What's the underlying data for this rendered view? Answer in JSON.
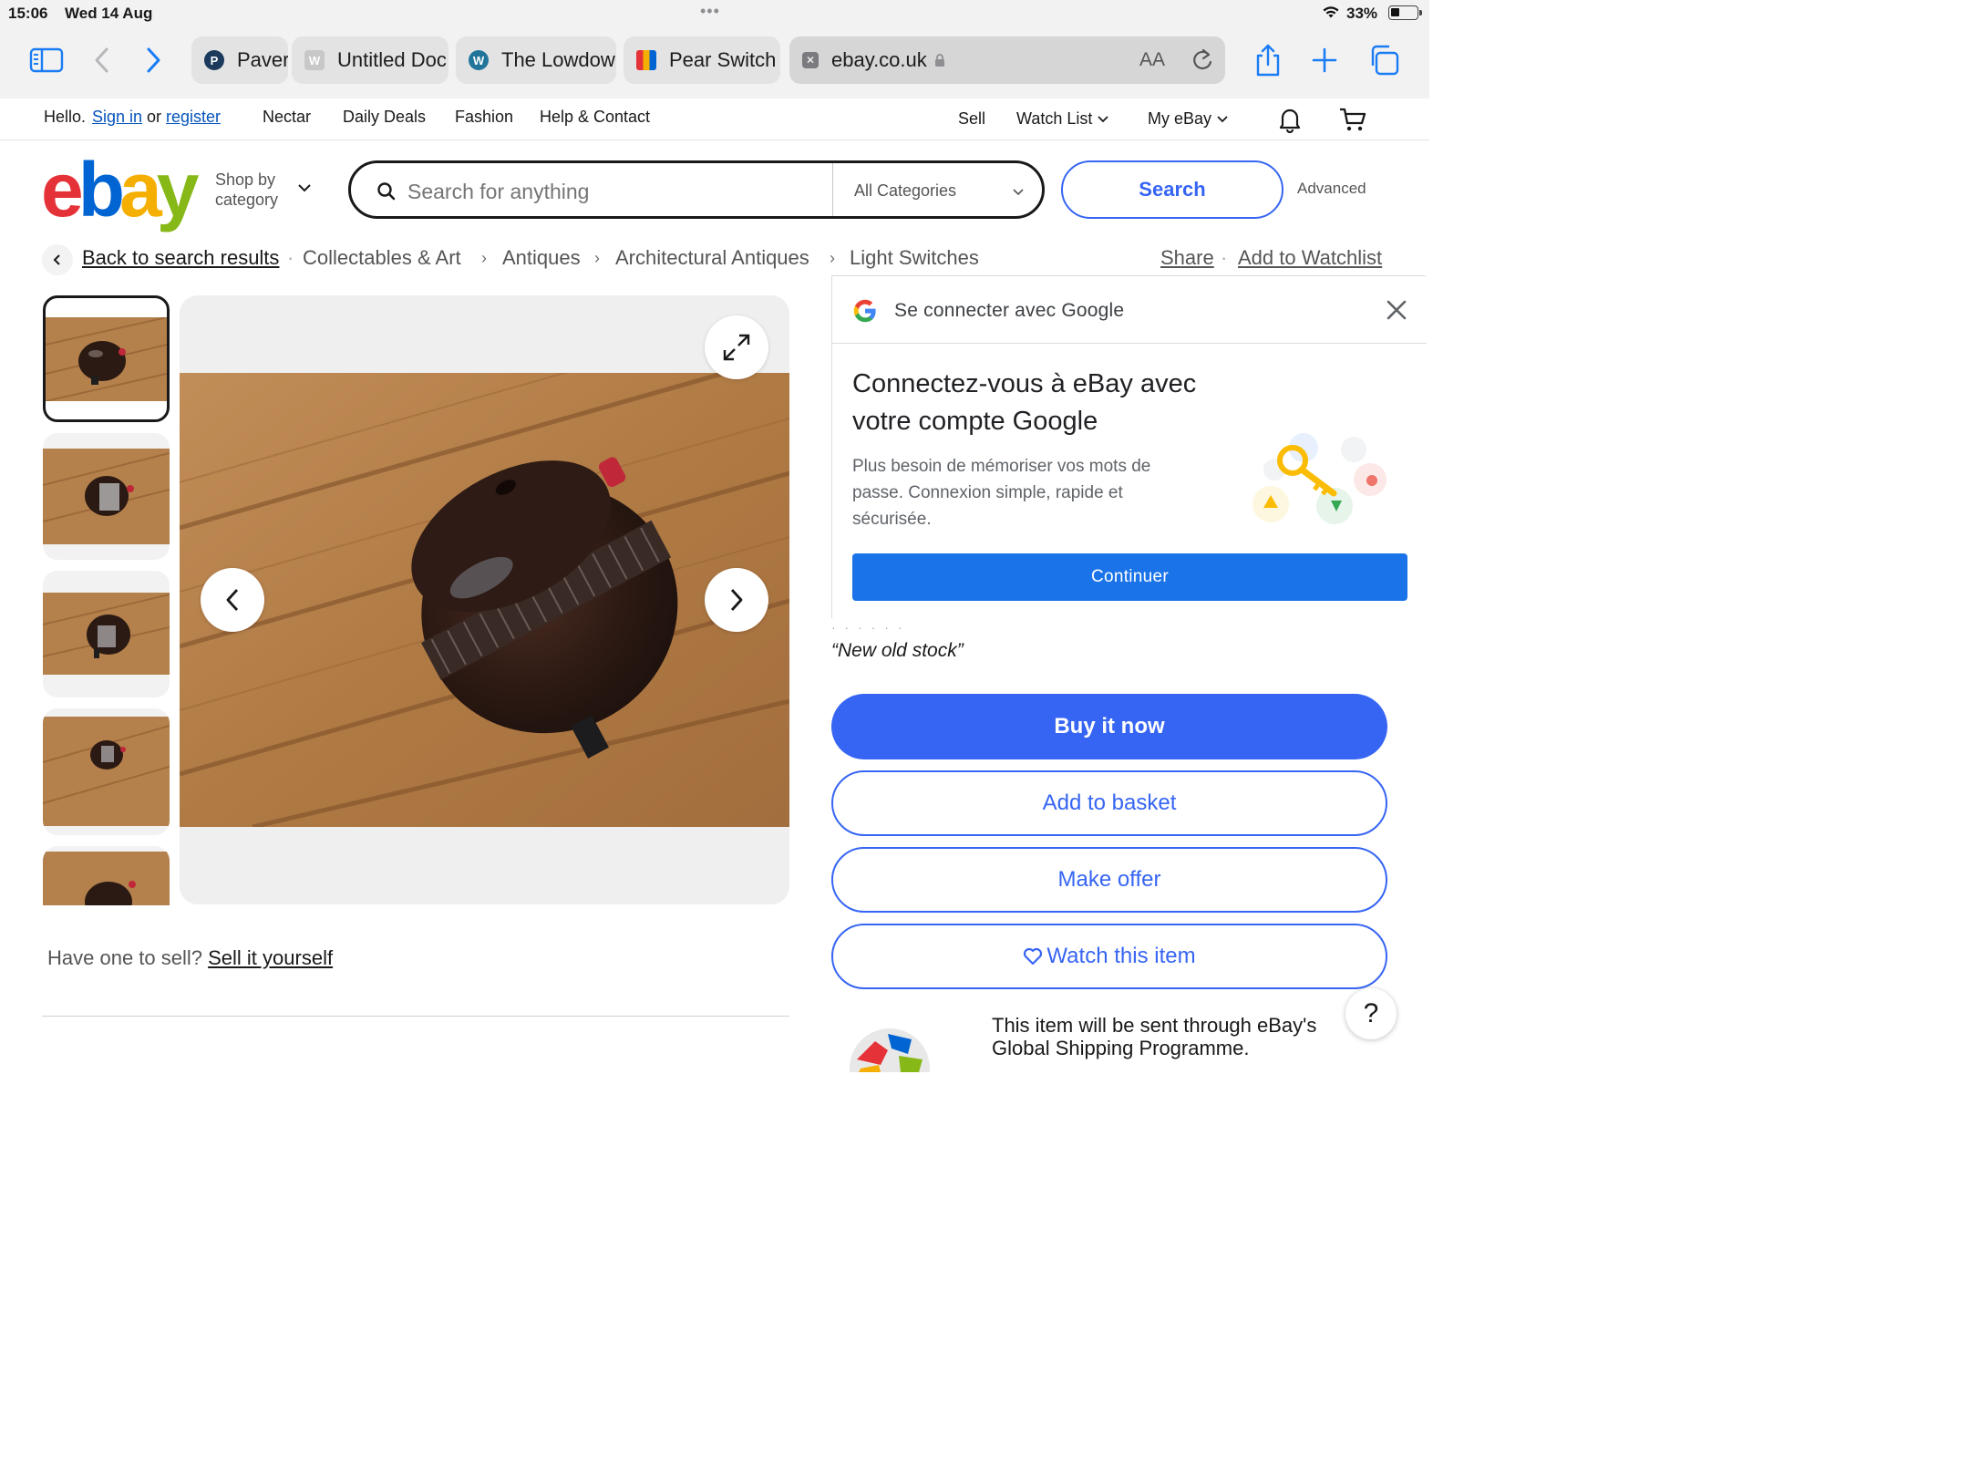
{
  "status": {
    "time": "15:06",
    "date": "Wed 14 Aug",
    "battery": "33%"
  },
  "browser": {
    "tabs": [
      {
        "title": "Paver"
      },
      {
        "title": "Untitled Doc"
      },
      {
        "title": "The Lowdow"
      },
      {
        "title": "Pear Switch"
      }
    ],
    "active_tab": {
      "url": "ebay.co.uk",
      "aa": "AA"
    }
  },
  "topnav": {
    "hello": "Hello.",
    "sign_in": "Sign in",
    "or": "or",
    "register": "register",
    "links": [
      "Nectar",
      "Daily Deals",
      "Fashion",
      "Help & Contact"
    ],
    "sell": "Sell",
    "watch_list": "Watch List",
    "my_ebay": "My eBay"
  },
  "header": {
    "logo": {
      "e": "e",
      "b": "b",
      "a": "a",
      "y": "y"
    },
    "shop_by_1": "Shop by",
    "shop_by_2": "category",
    "search_placeholder": "Search for anything",
    "category": "All Categories",
    "search_button": "Search",
    "advanced": "Advanced"
  },
  "breadcrumb": {
    "back": "Back to search results",
    "items": [
      "Collectables & Art",
      "Antiques",
      "Architectural Antiques",
      "Light Switches"
    ],
    "share": "Share",
    "watchlist": "Add to Watchlist"
  },
  "google": {
    "header": "Se connecter avec Google",
    "title": "Connectez-vous à eBay avec votre compte Google",
    "body": "Plus besoin de mémoriser vos mots de passe. Connexion simple, rapide et sécurisée.",
    "button": "Continuer"
  },
  "listing": {
    "quote": "“New old stock”",
    "buy_now": "Buy it now",
    "add_to_basket": "Add to basket",
    "make_offer": "Make offer",
    "watch": "Watch this item",
    "sell_prompt": "Have one to sell?",
    "sell_link": "Sell it yourself",
    "gsp": "This item will be sent through eBay's Global Shipping Programme."
  },
  "help_label": "?",
  "colors": {
    "ebay_blue": "#3665f3",
    "google_blue": "#1a73e8",
    "safari_blue": "#1a7cf5"
  }
}
